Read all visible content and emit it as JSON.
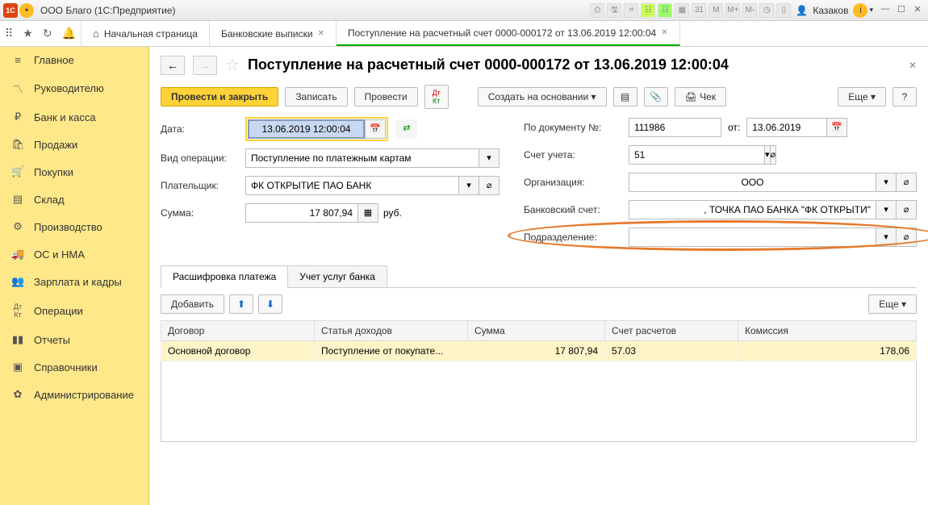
{
  "titlebar": {
    "logo": "1C",
    "title": "ООО Благо  (1С:Предприятие)",
    "user": "Казаков"
  },
  "tabs": {
    "home": "Начальная страница",
    "t1": "Банковские выписки",
    "t2": "Поступление на расчетный счет 0000-000172 от 13.06.2019 12:00:04"
  },
  "sidebar": {
    "items": [
      "Главное",
      "Руководителю",
      "Банк и касса",
      "Продажи",
      "Покупки",
      "Склад",
      "Производство",
      "ОС и НМА",
      "Зарплата и кадры",
      "Операции",
      "Отчеты",
      "Справочники",
      "Администрирование"
    ]
  },
  "page": {
    "title": "Поступление на расчетный счет 0000-000172 от 13.06.2019 12:00:04"
  },
  "cmd": {
    "post_close": "Провести и закрыть",
    "save": "Записать",
    "post": "Провести",
    "create_based": "Создать на основании",
    "check": "Чек",
    "more": "Еще",
    "help": "?"
  },
  "form": {
    "date_label": "Дата:",
    "date_value": "13.06.2019 12:00:04",
    "op_type_label": "Вид операции:",
    "op_type_value": "Поступление по платежным картам",
    "payer_label": "Плательщик:",
    "payer_value": "ФК ОТКРЫТИЕ ПАО БАНК",
    "sum_label": "Сумма:",
    "sum_value": "17 807,94",
    "sum_unit": "руб.",
    "doc_num_label": "По документу №:",
    "doc_num_value": "111986",
    "doc_from_label": "от:",
    "doc_from_value": "13.06.2019",
    "account_label": "Счет учета:",
    "account_value": "51",
    "org_label": "Организация:",
    "org_value": "ООО",
    "bank_acct_label": "Банковский счет:",
    "bank_acct_value": ", ТОЧКА ПАО БАНКА \"ФК ОТКРЫТИ\"",
    "division_label": "Подразделение:"
  },
  "subtabs": {
    "t1": "Расшифровка платежа",
    "t2": "Учет услуг банка"
  },
  "table": {
    "add": "Добавить",
    "more": "Еще",
    "cols": [
      "Договор",
      "Статья доходов",
      "Сумма",
      "Счет расчетов",
      "Комиссия"
    ],
    "row": {
      "contract": "Основной договор",
      "income": "Поступление от покупате...",
      "sum": "17 807,94",
      "acct": "57.03",
      "fee": "178,06"
    }
  }
}
